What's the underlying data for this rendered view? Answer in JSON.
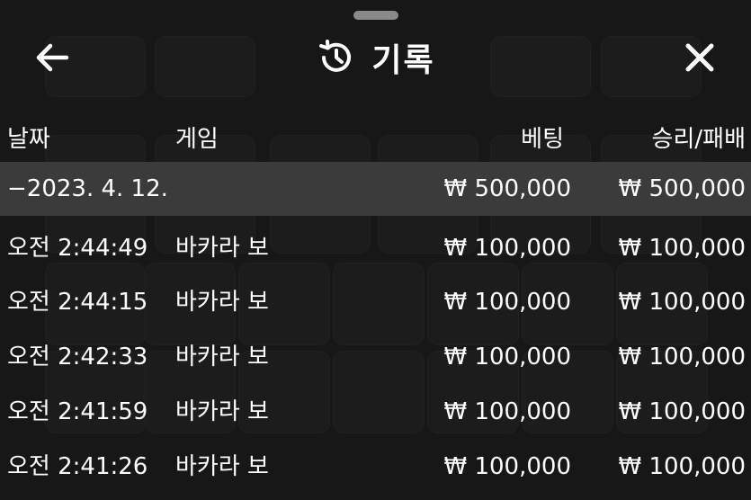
{
  "header": {
    "title": "기록",
    "back_icon": "arrow-left-icon",
    "history_icon": "history-clock-icon",
    "close_icon": "close-icon"
  },
  "columns": {
    "date": "날짜",
    "game": "게임",
    "bet": "베팅",
    "result": "승리/패배"
  },
  "summary": {
    "date": "−2023. 4. 12.",
    "game": "",
    "bet": "₩ 500,000",
    "result": "₩ 500,000"
  },
  "rows": [
    {
      "time": "오전 2:44:49",
      "game": "바카라 보",
      "bet": "₩ 100,000",
      "result": "₩ 100,000"
    },
    {
      "time": "오전 2:44:15",
      "game": "바카라 보",
      "bet": "₩ 100,000",
      "result": "₩ 100,000"
    },
    {
      "time": "오전 2:42:33",
      "game": "바카라 보",
      "bet": "₩ 100,000",
      "result": "₩ 100,000"
    },
    {
      "time": "오전 2:41:59",
      "game": "바카라 보",
      "bet": "₩ 100,000",
      "result": "₩ 100,000"
    },
    {
      "time": "오전 2:41:26",
      "game": "바카라 보",
      "bet": "₩ 100,000",
      "result": "₩ 100,000"
    }
  ],
  "colors": {
    "background": "#1c1c1c",
    "summary_row": "#3b3b3b",
    "text": "#ffffff"
  }
}
